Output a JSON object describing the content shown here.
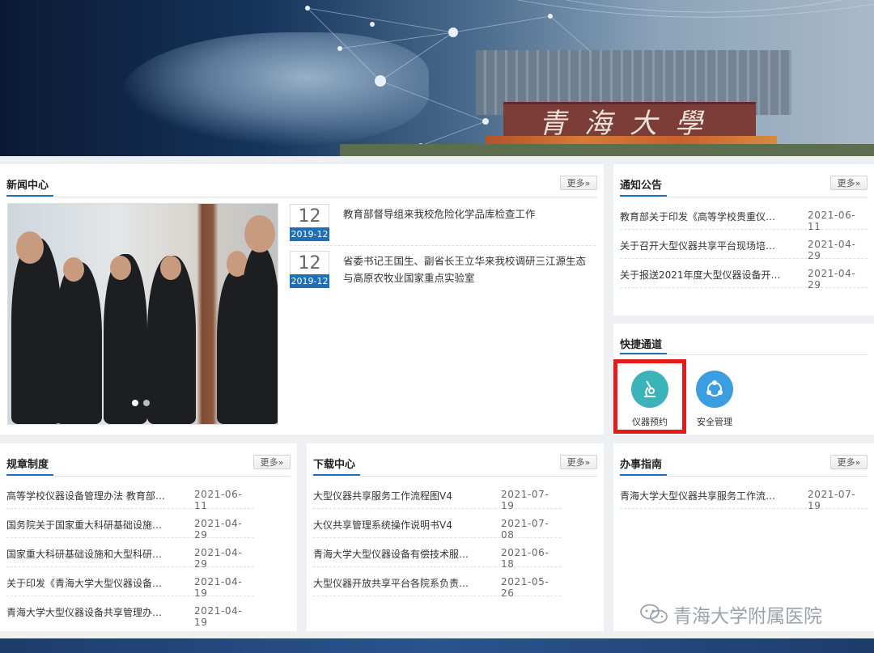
{
  "banner": {
    "campus_sign": "青海大學"
  },
  "news": {
    "title": "新闻中心",
    "more": "更多»",
    "items": [
      {
        "day": "12",
        "ym": "2019-12",
        "text": "教育部督导组来我校危险化学品库检查工作"
      },
      {
        "day": "12",
        "ym": "2019-12",
        "text": "省委书记王国生、副省长王立华来我校调研三江源生态与高原农牧业国家重点实验室"
      }
    ]
  },
  "notice": {
    "title": "通知公告",
    "more": "更多»",
    "items": [
      {
        "text": "教育部关于印发《高等学校贵重仪…",
        "date": "2021-06-11"
      },
      {
        "text": "关于召开大型仪器共享平台现场培…",
        "date": "2021-04-29"
      },
      {
        "text": "关于报送2021年度大型仪器设备开…",
        "date": "2021-04-29"
      }
    ]
  },
  "quick": {
    "title": "快捷通道",
    "buttons": [
      {
        "label": "仪器预约",
        "icon": "microscope-icon",
        "color": "#3ab3b9"
      },
      {
        "label": "安全管理",
        "icon": "network-icon",
        "color": "#3b9ee0"
      }
    ]
  },
  "rules": {
    "title": "规章制度",
    "more": "更多»",
    "items": [
      {
        "text": "高等学校仪器设备管理办法 教育部…",
        "date": "2021-06-11"
      },
      {
        "text": "国务院关于国家重大科研基础设施…",
        "date": "2021-04-29"
      },
      {
        "text": "国家重大科研基础设施和大型科研…",
        "date": "2021-04-29"
      },
      {
        "text": "关于印发《青海大学大型仪器设备…",
        "date": "2021-04-19"
      },
      {
        "text": "青海大学大型仪器设备共享管理办…",
        "date": "2021-04-19"
      }
    ]
  },
  "downloads": {
    "title": "下载中心",
    "more": "更多»",
    "items": [
      {
        "text": "大型仪器共享服务工作流程图V4",
        "date": "2021-07-19"
      },
      {
        "text": "大仪共享管理系统操作说明书V4",
        "date": "2021-07-08"
      },
      {
        "text": "青海大学大型仪器设备有偿技术服…",
        "date": "2021-06-18"
      },
      {
        "text": "大型仪器开放共享平台各院系负责…",
        "date": "2021-05-26"
      }
    ]
  },
  "guide": {
    "title": "办事指南",
    "more": "更多»",
    "items": [
      {
        "text": "青海大学大型仪器共享服务工作流…",
        "date": "2021-07-19"
      }
    ]
  },
  "watermark": {
    "text": "青海大学附属医院",
    "icon": "wechat-icon"
  }
}
